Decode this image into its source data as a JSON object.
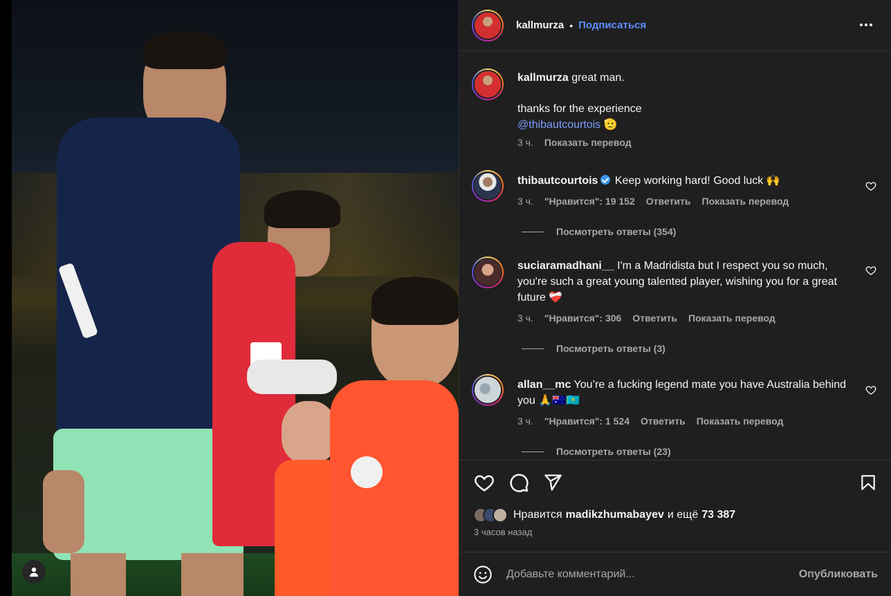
{
  "post": {
    "author": "kallmurza",
    "separator": "•",
    "follow_label": "Подписаться",
    "more_icon": "more-horizontal-icon"
  },
  "caption": {
    "user": "kallmurza",
    "line1": "great man.",
    "line2": "thanks for the experience",
    "mention": "@thibautcourtois",
    "emoji": "🫡",
    "time": "3 ч.",
    "translate": "Показать перевод"
  },
  "comments": [
    {
      "user": "thibautcourtois",
      "verified": true,
      "text": "Keep working hard! Good luck 🙌",
      "time": "3 ч.",
      "likes": "\"Нравится\": 19 152",
      "reply": "Ответить",
      "translate": "Показать перевод",
      "replies": "Посмотреть ответы (354)"
    },
    {
      "user": "suciaramadhani__",
      "verified": false,
      "text": "I'm a Madridista but I respect you so much, you're such a great young talented player, wishing you for a great future ❤️‍🩹",
      "time": "3 ч.",
      "likes": "\"Нравится\": 306",
      "reply": "Ответить",
      "translate": "Показать перевод",
      "replies": "Посмотреть ответы (3)"
    },
    {
      "user": "allan__mc",
      "verified": false,
      "text": "You’re a fucking legend mate you have Australia behind you 🙏🇦🇺🇰🇿",
      "time": "3 ч.",
      "likes": "\"Нравится\": 1 524",
      "reply": "Ответить",
      "translate": "Показать перевод",
      "replies": "Посмотреть ответы (23)"
    }
  ],
  "actions": {
    "like_icon": "heart-icon",
    "comment_icon": "comment-icon",
    "share_icon": "send-icon",
    "save_icon": "bookmark-icon"
  },
  "likes": {
    "prefix": "Нравится",
    "user": "madikzhumabayev",
    "middle": "и ещё",
    "count": "73 387"
  },
  "time_ago": "3 часов назад",
  "add_comment": {
    "placeholder": "Добавьте комментарий...",
    "publish": "Опубликовать",
    "emoji_icon": "smiley-icon"
  },
  "colors": {
    "panel_bg": "#1f1f1f",
    "link_blue": "#5c8cff",
    "muted": "#a8a8a8"
  }
}
